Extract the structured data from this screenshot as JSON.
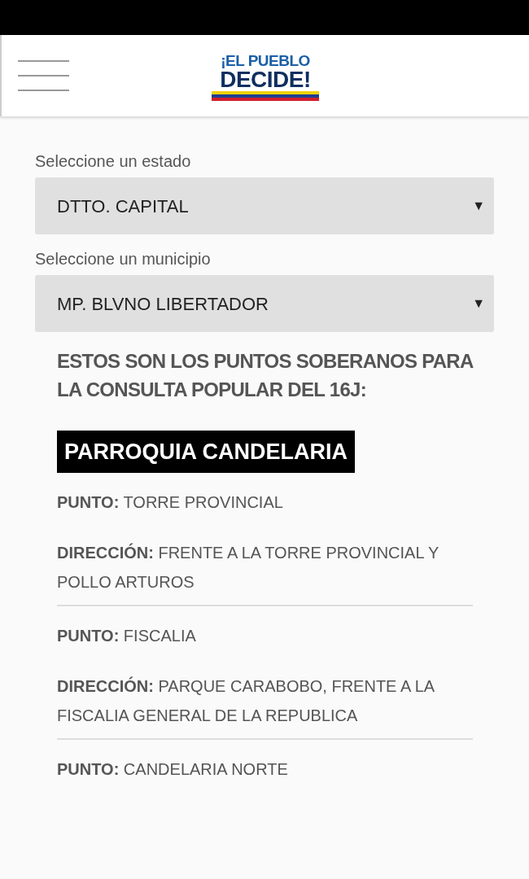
{
  "header": {
    "logo_line_1": "¡EL PUEBLO",
    "logo_line_2": "DECIDE!"
  },
  "selects": [
    {
      "label": "Seleccione un estado",
      "value": "DTTO. CAPITAL",
      "caret": "▼"
    },
    {
      "label": "Seleccione un municipio",
      "value": "MP. BLVNO LIBERTADOR",
      "caret": "▼"
    }
  ],
  "heading": "ESTOS SON LOS PUNTOS SOBERANOS PARA LA CONSULTA POPULAR DEL 16J:",
  "parish": "PARROQUIA CANDELARIA",
  "points": [
    {
      "punto": "**PUNTO:** TORRE PROVINCIAL",
      "direccion": "**DIRECCIÓN:** FRENTE A LA TORRE PROVINCIAL Y POLLO ARTUROS"
    },
    {
      "punto": "**PUNTO:** FISCALIA",
      "direccion": "**DIRECCIÓN:** PARQUE CARABOBO, FRENTE A LA FISCALIA GENERAL DE LA REPUBLICA"
    },
    {
      "punto": "**PUNTO:** CANDELARIA NORTE"
    }
  ]
}
